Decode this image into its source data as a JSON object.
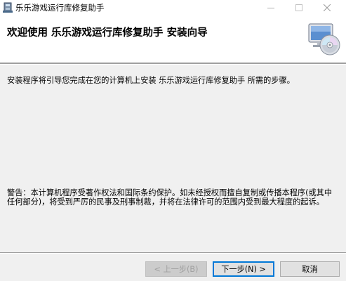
{
  "window": {
    "title": "乐乐游戏运行库修复助手"
  },
  "banner": {
    "title": "欢迎使用 乐乐游戏运行库修复助手 安装向导"
  },
  "content": {
    "intro": "安装程序将引导您完成在您的计算机上安装 乐乐游戏运行库修复助手 所需的步骤。",
    "warning": "警告：本计算机程序受著作权法和国际条约保护。如未经授权而擅自复制或传播本程序(或其中任何部分)，将受到严厉的民事及刑事制裁，并将在法律许可的范围内受到最大程度的起诉。"
  },
  "buttons": {
    "back": "< 上一步(B)",
    "next": "下一步(N) >",
    "cancel": "取消"
  },
  "icons": {
    "title": "installer-icon",
    "banner": "cd-computer-icon"
  },
  "colors": {
    "accent": "#0078d7",
    "window_bg": "#f0f0f0",
    "banner_bg": "#ffffff"
  }
}
